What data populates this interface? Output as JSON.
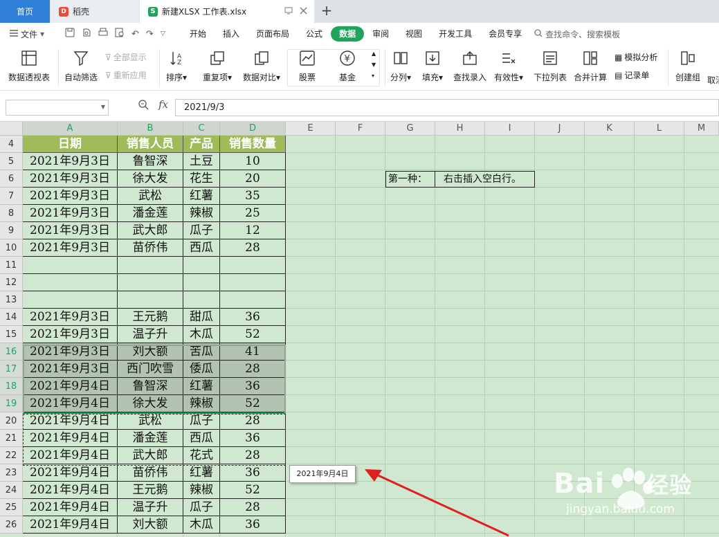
{
  "tabs": {
    "home": "首页",
    "daoke": "稻壳",
    "file": "新建XLSX 工作表.xlsx"
  },
  "menu": {
    "file_label": "文件",
    "tabs": [
      "开始",
      "插入",
      "页面布局",
      "公式",
      "数据",
      "审阅",
      "视图",
      "开发工具",
      "会员专享"
    ],
    "active_tab": "数据",
    "search_placeholder": "查找命令、搜索模板"
  },
  "ribbon": {
    "pivot": "数据透视表",
    "autofilter": "自动筛选",
    "show_all": "全部显示",
    "reapply": "重新应用",
    "sort": "排序",
    "duplicates": "重复项",
    "compare": "数据对比",
    "stock": "股票",
    "fund": "基金",
    "split": "分列",
    "fill": "填充",
    "lookup": "查找录入",
    "validity": "有效性",
    "dropdown": "下拉列表",
    "consolidate": "合并计算",
    "simulate": "模拟分析",
    "record": "记录单",
    "group": "创建组",
    "ungroup": "取消"
  },
  "formula_bar": {
    "name_box": "",
    "fx": "fx",
    "value": "2021/9/3"
  },
  "grid": {
    "columns": [
      "A",
      "B",
      "C",
      "D",
      "E",
      "F",
      "G",
      "H",
      "I",
      "J",
      "K",
      "L",
      "M"
    ],
    "rows": [
      "4",
      "5",
      "6",
      "7",
      "8",
      "9",
      "10",
      "11",
      "12",
      "13",
      "14",
      "15",
      "16",
      "17",
      "18",
      "19",
      "20",
      "21",
      "22",
      "23",
      "24",
      "25",
      "26"
    ],
    "header": [
      "日期",
      "销售人员",
      "产品",
      "销售数量"
    ],
    "data": [
      [
        "2021年9月3日",
        "鲁智深",
        "土豆",
        "10"
      ],
      [
        "2021年9月3日",
        "徐大发",
        "花生",
        "20"
      ],
      [
        "2021年9月3日",
        "武松",
        "红薯",
        "35"
      ],
      [
        "2021年9月3日",
        "潘金莲",
        "辣椒",
        "25"
      ],
      [
        "2021年9月3日",
        "武大郎",
        "瓜子",
        "12"
      ],
      [
        "2021年9月3日",
        "苗侨伟",
        "西瓜",
        "28"
      ],
      [
        "",
        "",
        "",
        ""
      ],
      [
        "",
        "",
        "",
        ""
      ],
      [
        "",
        "",
        "",
        ""
      ],
      [
        "2021年9月3日",
        "王元鹅",
        "甜瓜",
        "36"
      ],
      [
        "2021年9月3日",
        "温子升",
        "木瓜",
        "52"
      ],
      [
        "2021年9月3日",
        "刘大额",
        "苦瓜",
        "41"
      ],
      [
        "2021年9月3日",
        "西门吹雪",
        "倭瓜",
        "28"
      ],
      [
        "2021年9月4日",
        "鲁智深",
        "红薯",
        "36"
      ],
      [
        "2021年9月4日",
        "徐大发",
        "辣椒",
        "52"
      ],
      [
        "2021年9月4日",
        "武松",
        "瓜子",
        "28"
      ],
      [
        "2021年9月4日",
        "潘金莲",
        "西瓜",
        "36"
      ],
      [
        "2021年9月4日",
        "武大郎",
        "花式",
        "28"
      ],
      [
        "2021年9月4日",
        "苗侨伟",
        "红薯",
        "36"
      ],
      [
        "2021年9月4日",
        "王元鹅",
        "辣椒",
        "52"
      ],
      [
        "2021年9月4日",
        "温子升",
        "瓜子",
        "28"
      ],
      [
        "2021年9月4日",
        "刘大额",
        "木瓜",
        "36"
      ]
    ],
    "selected_rows": [
      "16",
      "17",
      "18",
      "19"
    ],
    "note_label": "第一种：",
    "note_text": "右击插入空白行。",
    "tooltip": "2021年9月4日"
  },
  "colors": {
    "accent": "#1fa45c",
    "header_fill": "#9fbb5a",
    "sheet_bg": "#cfe8cf",
    "arrow": "#e02020"
  },
  "watermark": {
    "brand": "Bai",
    "brand_suffix": "经验",
    "url": "jingyan.baidu.com"
  }
}
